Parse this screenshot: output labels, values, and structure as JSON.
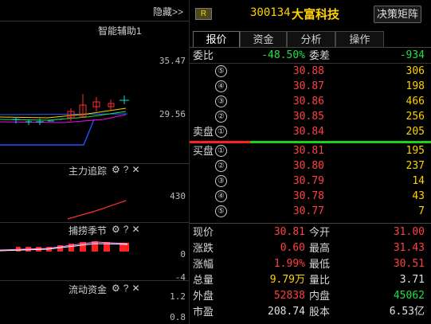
{
  "left": {
    "collapse_label": "隐藏>>",
    "indicator_main": "智能辅助1",
    "y_main": [
      "35.47",
      "29.56"
    ],
    "panel2": {
      "label": "主力追踪",
      "y": [
        "430"
      ]
    },
    "panel3": {
      "label": "捕捞季节",
      "y": [
        "0",
        "-4"
      ]
    },
    "panel4": {
      "label": "流动资金",
      "y": [
        "1.2",
        "0.8"
      ]
    },
    "icons": [
      "gear-icon",
      "help-icon",
      "close-icon"
    ],
    "icon_glyphs": {
      "gear": "⚙",
      "help": "?",
      "close": "✕"
    }
  },
  "header": {
    "badge": "R",
    "code": "300134",
    "name": "大富科技",
    "decision_button": "决策矩阵"
  },
  "tabs": [
    "报价",
    "资金",
    "分析",
    "操作"
  ],
  "quote": {
    "weibi_label": "委比",
    "weibi_value": "-48.50%",
    "weicha_label": "委差",
    "weicha_value": "-934",
    "sell": [
      {
        "label": "",
        "level": "⑤",
        "price": "30.88",
        "vol": "306"
      },
      {
        "label": "",
        "level": "④",
        "price": "30.87",
        "vol": "198"
      },
      {
        "label": "",
        "level": "③",
        "price": "30.86",
        "vol": "466"
      },
      {
        "label": "",
        "level": "②",
        "price": "30.85",
        "vol": "256"
      },
      {
        "label": "卖盘",
        "level": "①",
        "price": "30.84",
        "vol": "205"
      }
    ],
    "buy": [
      {
        "label": "买盘",
        "level": "①",
        "price": "30.81",
        "vol": "195"
      },
      {
        "label": "",
        "level": "②",
        "price": "30.80",
        "vol": "237"
      },
      {
        "label": "",
        "level": "③",
        "price": "30.79",
        "vol": "14"
      },
      {
        "label": "",
        "level": "④",
        "price": "30.78",
        "vol": "43"
      },
      {
        "label": "",
        "level": "⑤",
        "price": "30.77",
        "vol": "7"
      }
    ]
  },
  "stats": [
    {
      "l1": "现价",
      "v1": "30.81",
      "c1": "red",
      "l2": "今开",
      "v2": "31.00",
      "c2": "red"
    },
    {
      "l1": "涨跌",
      "v1": "0.60",
      "c1": "red",
      "l2": "最高",
      "v2": "31.43",
      "c2": "red"
    },
    {
      "l1": "涨幅",
      "v1": "1.99%",
      "c1": "red",
      "l2": "最低",
      "v2": "30.51",
      "c2": "red"
    },
    {
      "l1": "总量",
      "v1": "9.79万",
      "c1": "yellow",
      "l2": "量比",
      "v2": "3.71",
      "c2": "white"
    },
    {
      "l1": "外盘",
      "v1": "52838",
      "c1": "red",
      "l2": "内盘",
      "v2": "45062",
      "c2": "green"
    },
    {
      "l1": "市盈",
      "v1": "208.74",
      "c1": "white",
      "l2": "股本",
      "v2": "6.53亿",
      "c2": "white"
    }
  ]
}
